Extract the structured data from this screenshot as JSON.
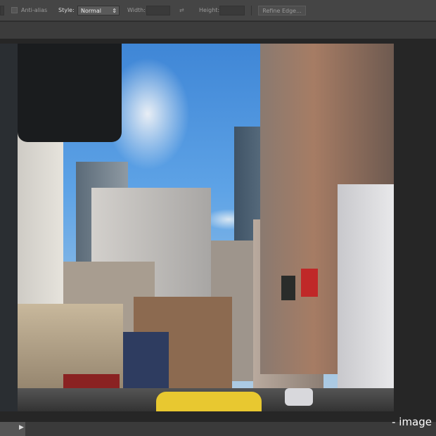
{
  "toolbar": {
    "anti_alias": "Anti-alias",
    "style_label": "Style:",
    "style_value": "Normal",
    "width_label": "Width:",
    "height_label": "Height:",
    "refine_edge": "Refine Edge..."
  },
  "caption": "- image"
}
